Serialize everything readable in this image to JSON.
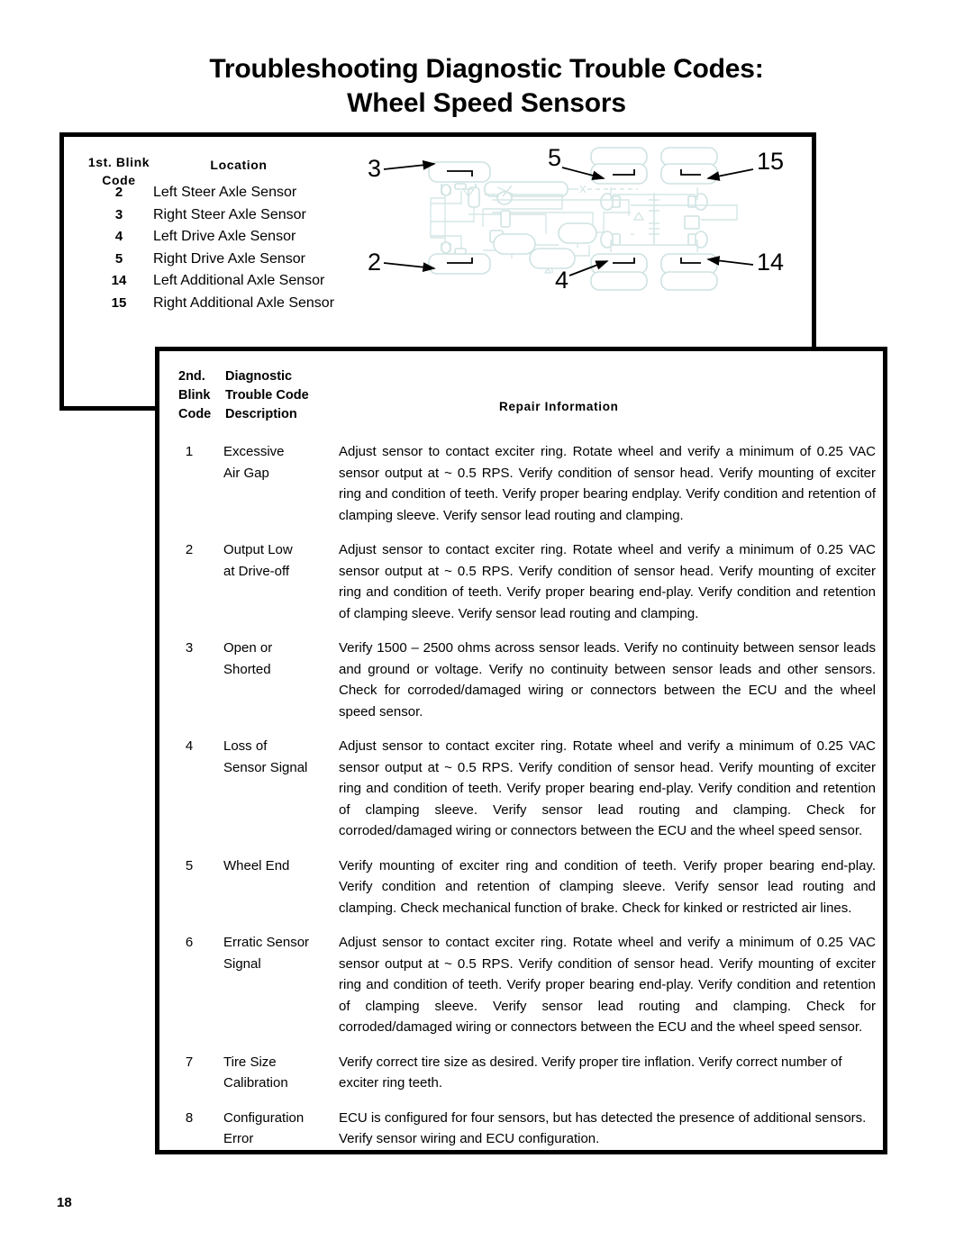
{
  "title": {
    "line1": "Troubleshooting Diagnostic Trouble Codes:",
    "line2": "Wheel Speed Sensors"
  },
  "blink_code_table": {
    "header": {
      "code_line1": "1st. Blink",
      "code_line2": "Code",
      "location": "Location"
    },
    "rows": [
      {
        "code": "2",
        "location": "Left Steer Axle Sensor"
      },
      {
        "code": "3",
        "location": "Right Steer Axle Sensor"
      },
      {
        "code": "4",
        "location": "Left Drive Axle Sensor"
      },
      {
        "code": "5",
        "location": "Right Drive Axle Sensor"
      },
      {
        "code": "14",
        "location": "Left Additional Axle Sensor"
      },
      {
        "code": "15",
        "location": "Right Additional Axle Sensor"
      }
    ]
  },
  "diagram": {
    "name": "air-brake-system-schematic",
    "outline_color": "#cfe2e2",
    "callouts": [
      {
        "label": "3",
        "position": "upper-left"
      },
      {
        "label": "2",
        "position": "lower-left"
      },
      {
        "label": "5",
        "position": "upper-center"
      },
      {
        "label": "4",
        "position": "lower-center"
      },
      {
        "label": "15",
        "position": "upper-right"
      },
      {
        "label": "14",
        "position": "lower-right"
      }
    ]
  },
  "trouble_code_table": {
    "header": {
      "blink_line1": "2nd.",
      "blink_line2": "Blink",
      "blink_line3": "Code",
      "desc_line1": "Diagnostic",
      "desc_line2": "Trouble Code",
      "desc_line3": "Description",
      "repair": "Repair Information"
    },
    "rows": [
      {
        "code": "1",
        "desc_line1": "Excessive",
        "desc_line2": "Air Gap",
        "repair": "Adjust sensor to contact exciter ring. Rotate wheel and verify a minimum of 0.25 VAC sensor output at ~ 0.5 RPS. Verify condition of sensor head. Verify mounting of exciter ring and condition of teeth. Verify proper bearing endplay.  Verify condition and retention of clamping sleeve.  Verify sensor lead routing and clamping."
      },
      {
        "code": "2",
        "desc_line1": "Output Low",
        "desc_line2": "at Drive-off",
        "repair": "Adjust sensor to contact exciter ring.  Rotate wheel and verify a minimum of 0.25 VAC sensor output at ~ 0.5 RPS.  Verify condition of sensor head.  Verify mounting of exciter ring and condition of teeth. Verify proper bearing end-play.  Verify condition and retention of clamping sleeve.  Verify sensor lead routing and clamping."
      },
      {
        "code": "3",
        "desc_line1": "Open or",
        "desc_line2": "Shorted",
        "repair": "Verify 1500 – 2500 ohms across sensor leads.  Verify no continuity between sensor leads and ground or voltage. Verify no continuity between sensor leads and other sensors.  Check for corroded/damaged wiring or connectors between the ECU and the wheel speed sensor."
      },
      {
        "code": "4",
        "desc_line1": "Loss of",
        "desc_line2": "Sensor Signal",
        "repair": "Adjust sensor to contact exciter ring.  Rotate wheel and verify a minimum of 0.25 VAC sensor output at ~ 0.5 RPS.  Verify condition of sensor head.  Verify mounting of exciter ring and condition of teeth. Verify proper bearing end-play.  Verify condition and retention of clamping sleeve.  Verify sensor lead routing and clamping.  Check for corroded/damaged wiring or connectors between the ECU and the wheel speed sensor."
      },
      {
        "code": "5",
        "desc_line1": "Wheel End",
        "desc_line2": "",
        "repair": "Verify mounting of exciter ring and condition of teeth. Verify proper bearing end-play.  Verify condition and retention of clamping sleeve.  Verify sensor lead routing and clamping.  Check mechanical function of brake. Check for kinked or restricted air lines."
      },
      {
        "code": "6",
        "desc_line1": "Erratic Sensor",
        "desc_line2": "Signal",
        "repair": "Adjust sensor to contact exciter ring.  Rotate wheel and verify a minimum of 0.25 VAC sensor output at ~ 0.5 RPS. Verify condition of sensor head.  Verify mounting of exciter ring and condition of teeth. Verify proper bearing end-play.  Verify condition and retention of clamping sleeve.  Verify sensor lead routing and clamping.  Check for corroded/damaged wiring or connectors between the ECU and the wheel speed sensor."
      },
      {
        "code": "7",
        "desc_line1": "Tire Size",
        "desc_line2": "Calibration",
        "repair": "Verify correct tire size as desired.  Verify proper tire inflation.  Verify correct number of exciter ring teeth."
      },
      {
        "code": "8",
        "desc_line1": "Configuration",
        "desc_line2": "Error",
        "repair": "ECU is configured for four sensors, but has detected the presence of additional sensors.   Verify sensor wiring and ECU configuration."
      }
    ]
  },
  "footer": {
    "page_number": "18"
  }
}
